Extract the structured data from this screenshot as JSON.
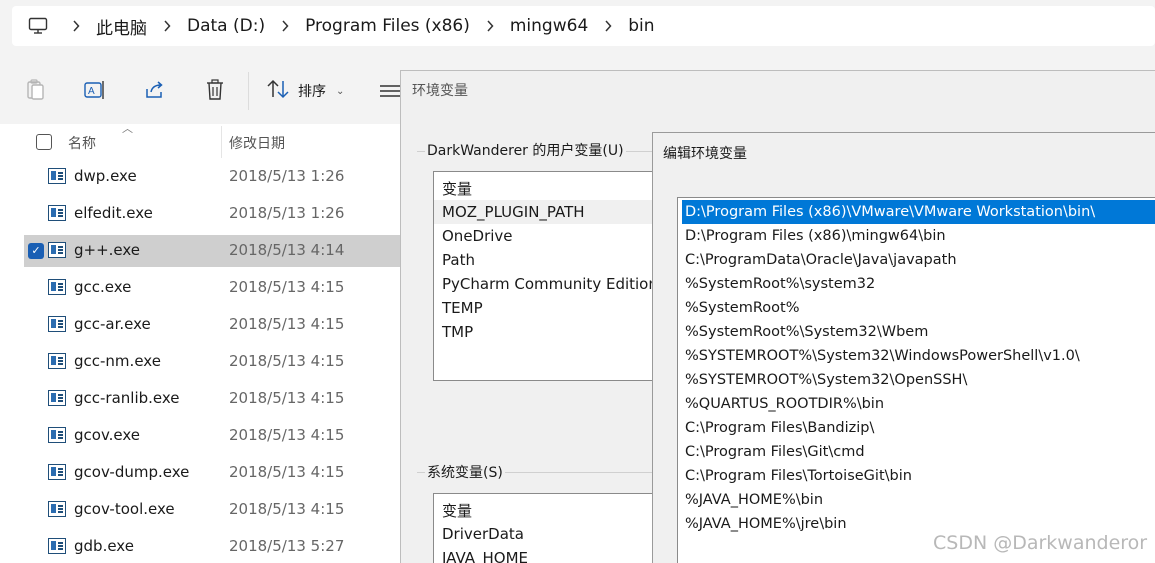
{
  "breadcrumb": {
    "icon": "computer-icon",
    "items": [
      "此电脑",
      "Data (D:)",
      "Program Files (x86)",
      "mingw64",
      "bin"
    ]
  },
  "toolbar": {
    "sort_label": "排序",
    "icons": [
      "paste-icon",
      "rename-icon",
      "share-icon",
      "delete-icon",
      "sort-icon",
      "view-icon"
    ]
  },
  "filelist": {
    "columns": {
      "name": "名称",
      "date": "修改日期"
    },
    "rows": [
      {
        "name": "dwp.exe",
        "date": "2018/5/13 1:26",
        "selected": false
      },
      {
        "name": "elfedit.exe",
        "date": "2018/5/13 1:26",
        "selected": false
      },
      {
        "name": "g++.exe",
        "date": "2018/5/13 4:14",
        "selected": true
      },
      {
        "name": "gcc.exe",
        "date": "2018/5/13 4:15",
        "selected": false
      },
      {
        "name": "gcc-ar.exe",
        "date": "2018/5/13 4:15",
        "selected": false
      },
      {
        "name": "gcc-nm.exe",
        "date": "2018/5/13 4:15",
        "selected": false
      },
      {
        "name": "gcc-ranlib.exe",
        "date": "2018/5/13 4:15",
        "selected": false
      },
      {
        "name": "gcov.exe",
        "date": "2018/5/13 4:15",
        "selected": false
      },
      {
        "name": "gcov-dump.exe",
        "date": "2018/5/13 4:15",
        "selected": false
      },
      {
        "name": "gcov-tool.exe",
        "date": "2018/5/13 4:15",
        "selected": false
      },
      {
        "name": "gdb.exe",
        "date": "2018/5/13 5:27",
        "selected": false
      }
    ]
  },
  "env_dialog": {
    "title": "环境变量",
    "user_group_label": "DarkWanderer 的用户变量(U)",
    "user_header": "变量",
    "user_vars": [
      "MOZ_PLUGIN_PATH",
      "OneDrive",
      "Path",
      "PyCharm Community Edition",
      "TEMP",
      "TMP"
    ],
    "system_group_label": "系统变量(S)",
    "system_header": "变量",
    "system_vars": [
      "DriverData",
      "JAVA_HOME"
    ]
  },
  "edit_dialog": {
    "title": "编辑环境变量",
    "paths": [
      "D:\\Program Files (x86)\\VMware\\VMware Workstation\\bin\\",
      "D:\\Program Files (x86)\\mingw64\\bin",
      "C:\\ProgramData\\Oracle\\Java\\javapath",
      "%SystemRoot%\\system32",
      "%SystemRoot%",
      "%SystemRoot%\\System32\\Wbem",
      "%SYSTEMROOT%\\System32\\WindowsPowerShell\\v1.0\\",
      "%SYSTEMROOT%\\System32\\OpenSSH\\",
      "%QUARTUS_ROOTDIR%\\bin",
      "C:\\Program Files\\Bandizip\\",
      "C:\\Program Files\\Git\\cmd",
      "C:\\Program Files\\TortoiseGit\\bin",
      "%JAVA_HOME%\\bin",
      "%JAVA_HOME%\\jre\\bin"
    ],
    "selected_index": 0
  },
  "watermark": "CSDN @Darkwanderor",
  "colors": {
    "selection_blue": "#0078d7",
    "row_selected": "#cfcfcf",
    "checkbox_blue": "#1a5fb4"
  }
}
